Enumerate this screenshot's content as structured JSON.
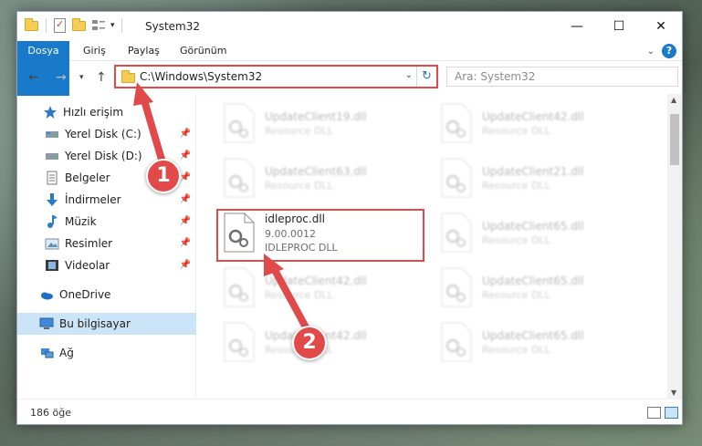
{
  "window": {
    "title": "System32",
    "controls": {
      "minimize": "—",
      "maximize": "☐",
      "close": "✕"
    }
  },
  "ribbon": {
    "tabs": [
      "Dosya",
      "Giriş",
      "Paylaş",
      "Görünüm"
    ],
    "expand_icon": "chevron-down-icon",
    "help_label": "?"
  },
  "address": {
    "path": "C:\\Windows\\System32",
    "search_placeholder": "Ara: System32"
  },
  "sidebar": {
    "items": [
      {
        "label": "Hızlı erişim",
        "icon": "star-icon"
      },
      {
        "label": "Yerel Disk (C:)",
        "icon": "drive-icon",
        "pinned": true
      },
      {
        "label": "Yerel Disk (D:)",
        "icon": "drive-icon",
        "pinned": true
      },
      {
        "label": "Belgeler",
        "icon": "documents-icon",
        "pinned": true
      },
      {
        "label": "İndirmeler",
        "icon": "downloads-icon",
        "pinned": true
      },
      {
        "label": "Müzik",
        "icon": "music-icon",
        "pinned": true
      },
      {
        "label": "Resimler",
        "icon": "pictures-icon",
        "pinned": true
      },
      {
        "label": "Videolar",
        "icon": "videos-icon",
        "pinned": true
      },
      {
        "label": "OneDrive",
        "icon": "onedrive-icon"
      },
      {
        "label": "Bu bilgisayar",
        "icon": "computer-icon",
        "selected": true
      },
      {
        "label": "Ağ",
        "icon": "network-icon"
      }
    ]
  },
  "files": [
    {
      "name": "UpdateClient19.dll",
      "desc": "Resource DLL"
    },
    {
      "name": "UpdateClient42.dll",
      "desc": "Resource DLL"
    },
    {
      "name": "UpdateClient63.dll",
      "desc": "Resource DLL"
    },
    {
      "name": "UpdateClient21.dll",
      "desc": "Resource DLL"
    },
    {
      "name": "idleproc.dll",
      "version": "9.00.0012",
      "desc": "IDLEPROC DLL"
    },
    {
      "name": "UpdateClient65.dll",
      "desc": "Resource DLL"
    },
    {
      "name": "UpdateClient42.dll",
      "desc": "Resource DLL"
    },
    {
      "name": "UpdateClient65.dll",
      "desc": "Resource DLL"
    },
    {
      "name": "UpdateClient42.dll",
      "desc": "Resource DLL"
    },
    {
      "name": "UpdateClient65.dll",
      "desc": "Resource DLL"
    }
  ],
  "status": {
    "item_count": "186 öğe"
  },
  "annotations": {
    "badge1": "1",
    "badge2": "2",
    "color": "#e04a4a"
  }
}
